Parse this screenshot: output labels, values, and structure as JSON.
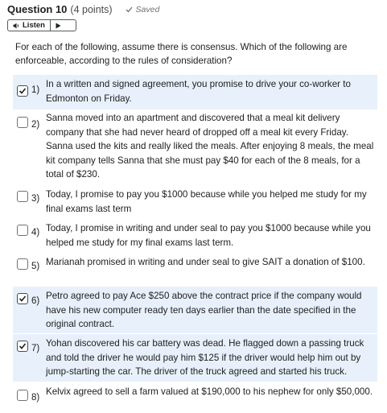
{
  "question": {
    "title": "Question 10",
    "points": "(4 points)",
    "saved_label": "Saved"
  },
  "listen": {
    "label": "Listen"
  },
  "prompt": "For each of the following, assume there is consensus. Which of the following are enforceable, according to the rules of consideration?",
  "options": [
    {
      "number": "1)",
      "checked": true,
      "text": "In a written and signed agreement, you promise to drive your co-worker to Edmonton on Friday."
    },
    {
      "number": "2)",
      "checked": false,
      "text": "Sanna moved into an apartment and discovered that a meal kit delivery company that she had never heard of dropped off a meal kit every Friday. Sanna used the kits and really liked the meals. After enjoying 8 meals, the meal kit company tells Sanna that she must pay $40 for each of the 8 meals, for a total of $230."
    },
    {
      "number": "3)",
      "checked": false,
      "text": "Today, I promise to pay you $1000 because while you helped me study for my final exams last term"
    },
    {
      "number": "4)",
      "checked": false,
      "text": "Today, I promise in writing and under seal to pay you $1000 because while you helped me study for my final exams last term."
    },
    {
      "number": "5)",
      "checked": false,
      "text": "Marianah promised in writing and under seal to give SAIT a donation of $100."
    },
    {
      "number": "6)",
      "checked": true,
      "text": "Petro agreed to pay Ace $250 above the contract price if the company would have his new computer ready ten days earlier than the date specified in the original contract."
    },
    {
      "number": "7)",
      "checked": true,
      "text": "Yohan discovered his car battery was dead. He flagged down a passing truck and told the driver he would pay him $125 if the driver would help him out by jump-starting the car. The driver of the truck agreed and started his truck."
    },
    {
      "number": "8)",
      "checked": false,
      "text": "Kelvix agreed to sell a farm valued at $190,000 to his nephew for only $50,000."
    }
  ],
  "colors": {
    "selected_bg": "#e8f1fb",
    "text": "#202122",
    "muted": "#6e7376"
  }
}
